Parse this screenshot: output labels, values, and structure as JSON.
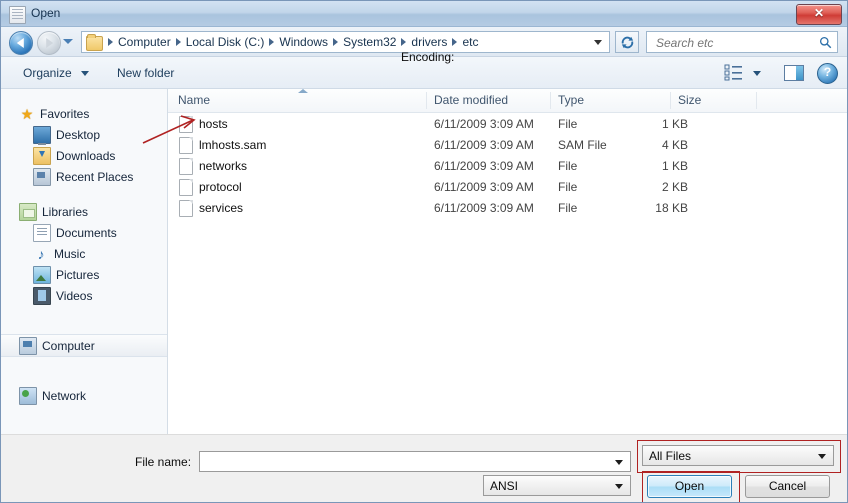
{
  "window": {
    "title": "Open",
    "close_label": "✖"
  },
  "address_bar": {
    "breadcrumbs": [
      "Computer",
      "Local Disk (C:)",
      "Windows",
      "System32",
      "drivers",
      "etc"
    ],
    "search_placeholder": "Search etc",
    "search_value": "",
    "refresh_icon": "refresh-icon",
    "back_icon": "back-arrow-icon",
    "forward_icon": "forward-arrow-icon",
    "history_icon": "chevron-down-icon"
  },
  "toolbar": {
    "organize_label": "Organize",
    "new_folder_label": "New folder",
    "view_icon": "view-mode-icon",
    "preview_icon": "preview-pane-icon",
    "help_label": "?"
  },
  "sidebar": {
    "groups": [
      {
        "label": "Favorites",
        "icon": "star-icon",
        "items": [
          {
            "label": "Desktop",
            "icon": "desktop-icon"
          },
          {
            "label": "Downloads",
            "icon": "downloads-icon"
          },
          {
            "label": "Recent Places",
            "icon": "recent-places-icon"
          }
        ]
      },
      {
        "label": "Libraries",
        "icon": "libraries-icon",
        "items": [
          {
            "label": "Documents",
            "icon": "documents-icon"
          },
          {
            "label": "Music",
            "icon": "music-icon"
          },
          {
            "label": "Pictures",
            "icon": "pictures-icon"
          },
          {
            "label": "Videos",
            "icon": "videos-icon"
          }
        ]
      }
    ],
    "computer": {
      "label": "Computer",
      "icon": "computer-icon",
      "selected": true
    },
    "network": {
      "label": "Network",
      "icon": "network-icon",
      "selected": false
    }
  },
  "filelist": {
    "columns": [
      "Name",
      "Date modified",
      "Type",
      "Size"
    ],
    "sort_column": "Name",
    "sort_direction": "ascending",
    "rows": [
      {
        "name": "hosts",
        "date": "6/11/2009 3:09 AM",
        "type": "File",
        "size": "1 KB"
      },
      {
        "name": "lmhosts.sam",
        "date": "6/11/2009 3:09 AM",
        "type": "SAM File",
        "size": "4 KB"
      },
      {
        "name": "networks",
        "date": "6/11/2009 3:09 AM",
        "type": "File",
        "size": "1 KB"
      },
      {
        "name": "protocol",
        "date": "6/11/2009 3:09 AM",
        "type": "File",
        "size": "2 KB"
      },
      {
        "name": "services",
        "date": "6/11/2009 3:09 AM",
        "type": "File",
        "size": "18 KB"
      }
    ]
  },
  "footer": {
    "filename_label": "File name:",
    "filename_value": "",
    "encoding_label": "Encoding:",
    "encoding_value": "ANSI",
    "filetype_value": "All Files",
    "open_label": "Open",
    "cancel_label": "Cancel"
  },
  "colors": {
    "titlebar_top": "#d3e2f2",
    "titlebar_bottom": "#a9c4de",
    "annotation_red": "#b02222",
    "close_red": "#cf3c36",
    "default_button_blue": "#2c7fb8"
  }
}
